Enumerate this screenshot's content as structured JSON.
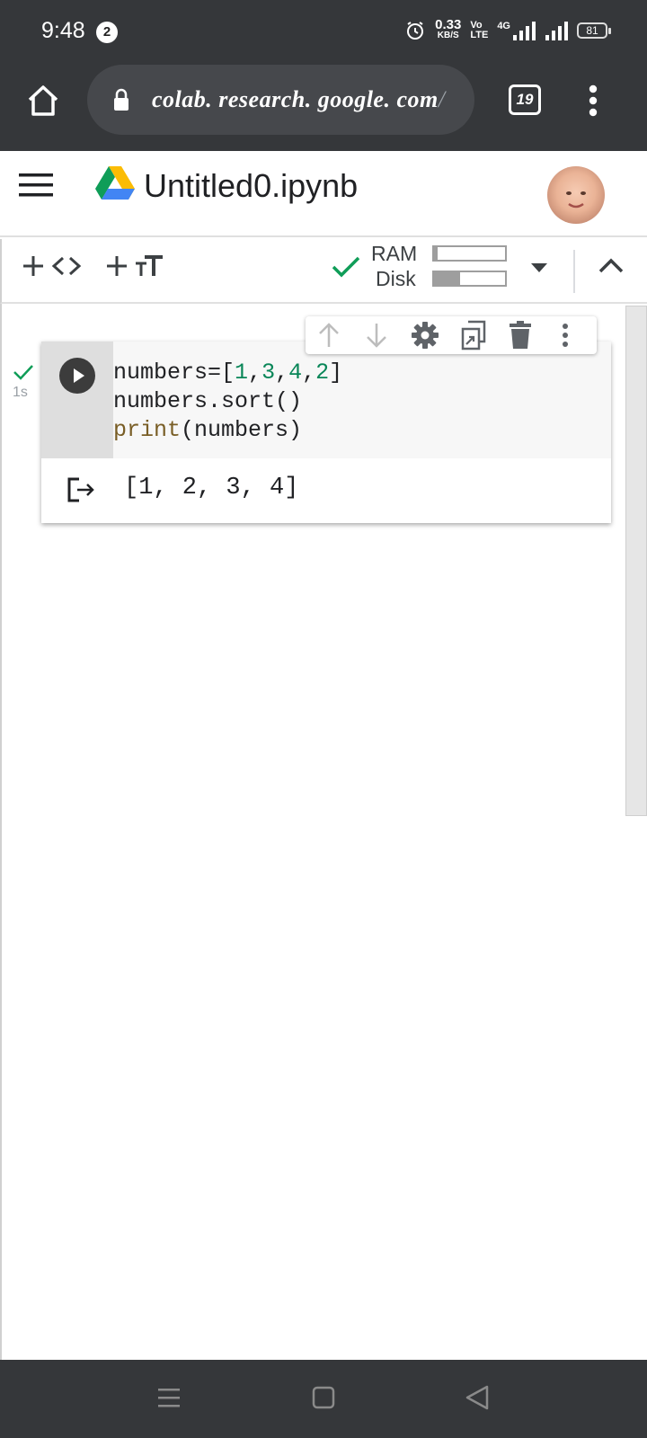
{
  "status_bar": {
    "time": "9:48",
    "notification_count": "2",
    "net_speed_value": "0.33",
    "net_speed_unit": "KB/S",
    "volte_top": "Vo",
    "volte_bottom": "LTE",
    "network": "4G",
    "battery": "81"
  },
  "browser": {
    "url": "colab. research. google. com",
    "url_suffix": "/",
    "tab_count": "19"
  },
  "app_header": {
    "title": "Untitled0.ipynb"
  },
  "toolbar": {
    "add_code_label": "+ <>",
    "add_text_label": "+ тT",
    "ram_label": "RAM",
    "disk_label": "Disk",
    "ram_usage": 0.05,
    "disk_usage": 0.37
  },
  "cell": {
    "exec_time": "1s",
    "code_lines": [
      [
        {
          "t": "numbers=[",
          "c": "plain"
        },
        {
          "t": "1",
          "c": "num"
        },
        {
          "t": ",",
          "c": "plain"
        },
        {
          "t": "3",
          "c": "num"
        },
        {
          "t": ",",
          "c": "plain"
        },
        {
          "t": "4",
          "c": "num"
        },
        {
          "t": ",",
          "c": "plain"
        },
        {
          "t": "2",
          "c": "num"
        },
        {
          "t": "]",
          "c": "plain"
        }
      ],
      [
        {
          "t": "numbers.sort()",
          "c": "plain"
        }
      ],
      [
        {
          "t": "print",
          "c": "kw"
        },
        {
          "t": "(numbers)",
          "c": "plain"
        }
      ]
    ],
    "output": "[1, 2, 3, 4]"
  },
  "colors": {
    "accent_green": "#0f9d58",
    "status_bg": "#35373a"
  }
}
